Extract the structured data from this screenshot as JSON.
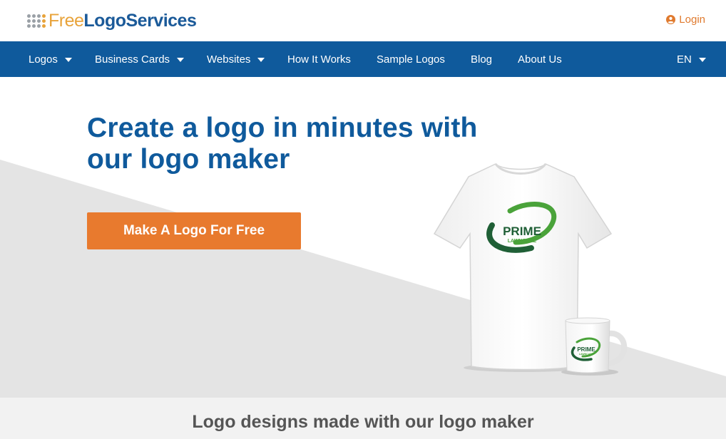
{
  "header": {
    "logo": {
      "part1": "Free",
      "part2": "LogoServices"
    },
    "login_label": "Login"
  },
  "nav": {
    "items": [
      {
        "label": "Logos",
        "dropdown": true
      },
      {
        "label": "Business Cards",
        "dropdown": true
      },
      {
        "label": "Websites",
        "dropdown": true
      },
      {
        "label": "How It Works",
        "dropdown": false
      },
      {
        "label": "Sample Logos",
        "dropdown": false
      },
      {
        "label": "Blog",
        "dropdown": false
      },
      {
        "label": "About Us",
        "dropdown": false
      }
    ],
    "language": "EN"
  },
  "hero": {
    "title_line1": "Create a logo in minutes with",
    "title_line2": "our logo maker",
    "cta_label": "Make A Logo For Free",
    "sample_logo": {
      "word1": "PRIME",
      "word2": "LAWNCARE"
    }
  },
  "section": {
    "title": "Logo designs made with our logo maker"
  },
  "colors": {
    "brand_blue": "#0f5a9c",
    "accent_orange": "#e87a2e",
    "logo_green": "#3a9a3a",
    "logo_dark_green": "#1f5f36"
  }
}
